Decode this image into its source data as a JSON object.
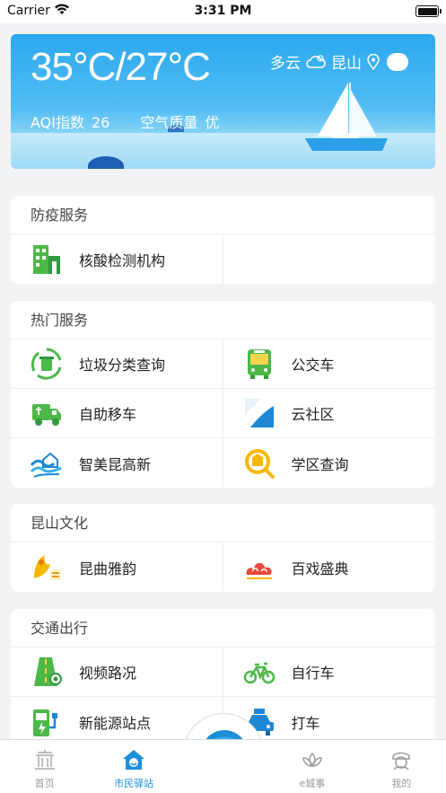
{
  "status_bar": {
    "carrier": "Carrier",
    "time": "3:31 PM"
  },
  "weather": {
    "temperature": "35°C/27°C",
    "condition": "多云",
    "city": "昆山",
    "aqi_label": "AQI指数",
    "aqi_value": "26",
    "quality_label": "空气质量",
    "quality_value": "优"
  },
  "sections": {
    "epidemic": {
      "title": "防疫服务",
      "items": [
        {
          "label": "核酸检测机构",
          "icon": "building-icon"
        }
      ]
    },
    "hot": {
      "title": "热门服务",
      "items": [
        {
          "label": "垃圾分类查询",
          "icon": "recycle-bin-icon"
        },
        {
          "label": "公交车",
          "icon": "bus-icon"
        },
        {
          "label": "自助移车",
          "icon": "truck-icon"
        },
        {
          "label": "云社区",
          "icon": "cloud-community-icon"
        },
        {
          "label": "智美昆高新",
          "icon": "wave-house-icon"
        },
        {
          "label": "学区查询",
          "icon": "school-search-icon"
        }
      ]
    },
    "culture": {
      "title": "昆山文化",
      "items": [
        {
          "label": "昆曲雅韵",
          "icon": "kunqu-icon"
        },
        {
          "label": "百戏盛典",
          "icon": "opera-cloud-icon"
        }
      ]
    },
    "traffic": {
      "title": "交通出行",
      "items": [
        {
          "label": "视频路况",
          "icon": "road-camera-icon"
        },
        {
          "label": "自行车",
          "icon": "bicycle-icon"
        },
        {
          "label": "新能源站点",
          "icon": "charging-station-icon"
        },
        {
          "label": "打车",
          "icon": "taxi-icon"
        }
      ]
    }
  },
  "tabs": [
    {
      "label": "首页",
      "icon": "home-pavilion-icon"
    },
    {
      "label": "市民驿站",
      "icon": "citizen-station-icon",
      "active": true
    },
    {
      "label": "",
      "icon": "center-mascot-icon"
    },
    {
      "label": "e城事",
      "icon": "lotus-icon"
    },
    {
      "label": "我的",
      "icon": "profile-icon"
    }
  ],
  "colors": {
    "accent": "#1d8fd8",
    "weather_top": "#2aa8ef",
    "green": "#4cb848"
  }
}
